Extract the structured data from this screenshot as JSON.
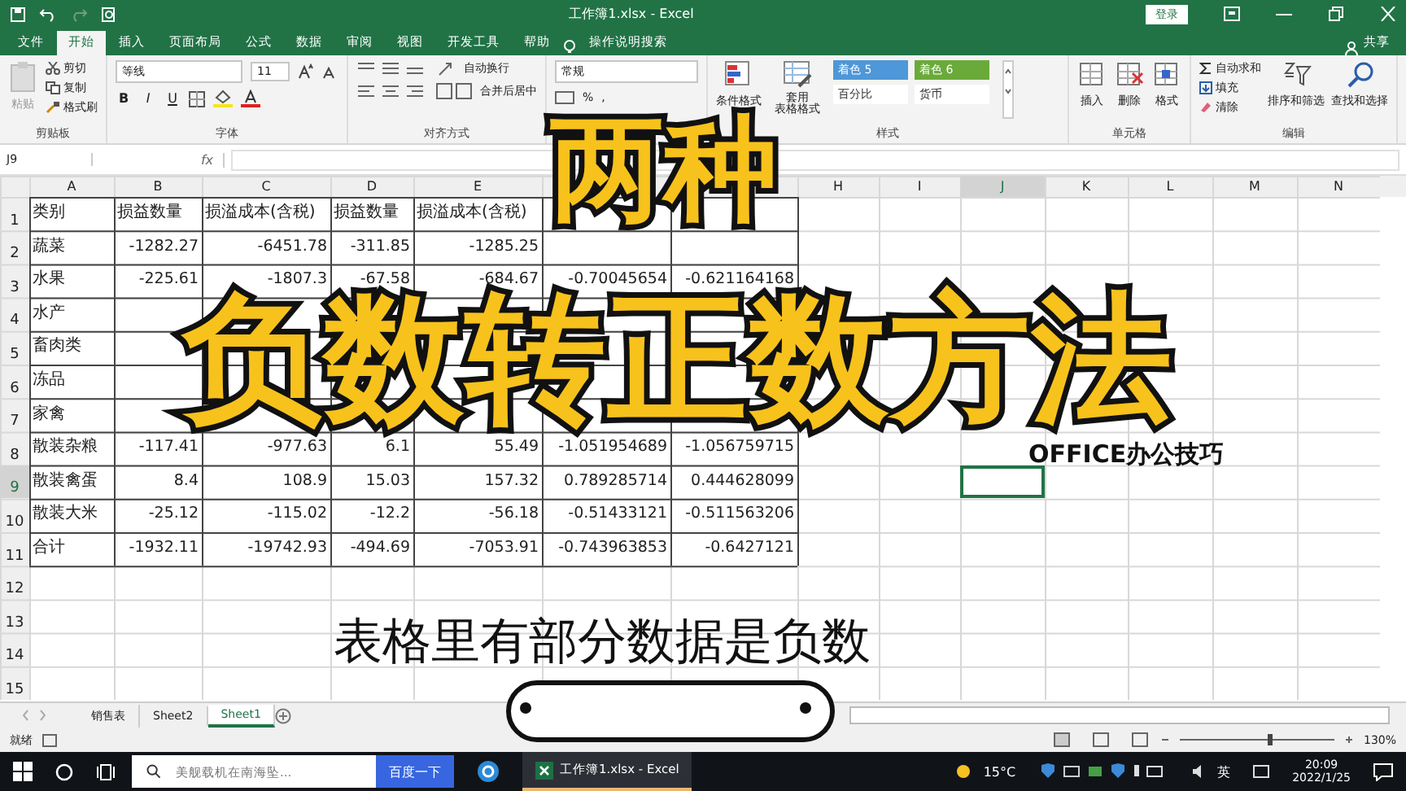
{
  "window": {
    "title": "工作簿1.xlsx - Excel",
    "login": "登录"
  },
  "ribbon_tabs": [
    {
      "label": "文件",
      "selected": false
    },
    {
      "label": "开始",
      "selected": true
    },
    {
      "label": "插入",
      "selected": false
    },
    {
      "label": "页面布局",
      "selected": false
    },
    {
      "label": "公式",
      "selected": false
    },
    {
      "label": "数据",
      "selected": false
    },
    {
      "label": "审阅",
      "selected": false
    },
    {
      "label": "视图",
      "selected": false
    },
    {
      "label": "开发工具",
      "selected": false
    },
    {
      "label": "帮助",
      "selected": false
    }
  ],
  "tell_me": "操作说明搜索",
  "share": "共享",
  "clipboard": {
    "paste": "粘贴",
    "cut": "剪切",
    "copy": "复制",
    "format_painter": "格式刷",
    "group": "剪贴板"
  },
  "font": {
    "name": "等线",
    "size": "11",
    "bold": "B",
    "italic": "I",
    "underline": "U",
    "group": "字体"
  },
  "alignment": {
    "wrap": "自动换行",
    "merge": "合并后居中",
    "group": "对齐方式"
  },
  "number": {
    "format": "常规",
    "percent": "%",
    "comma": ","
  },
  "styles": {
    "conditional": "条件格式",
    "table_format": [
      "套用",
      "表格格式"
    ],
    "gallery": [
      {
        "label": "着色 5",
        "color": "#4e97d8"
      },
      {
        "label": "着色 6",
        "color": "#6aaa3a"
      },
      {
        "label": "百分比",
        "color": "#ffffff"
      },
      {
        "label": "货币",
        "color": "#ffffff"
      }
    ],
    "group": "样式"
  },
  "cells_group": {
    "items": [
      "插入",
      "删除",
      "格式"
    ],
    "group": "单元格"
  },
  "editing": {
    "autosum": "自动求和",
    "fill": "填充",
    "clear": "清除",
    "sort": "排序和筛选",
    "find": "查找和选择",
    "group": "编辑"
  },
  "formula_bar": {
    "name_box": "J9",
    "fx": "fx"
  },
  "sheet": {
    "columns": [
      {
        "label": "A",
        "selected": false
      },
      {
        "label": "B",
        "selected": false
      },
      {
        "label": "C",
        "selected": false
      },
      {
        "label": "D",
        "selected": false
      },
      {
        "label": "E",
        "selected": false
      },
      {
        "selected": false
      },
      {
        "selected": false
      },
      {
        "label": "H",
        "selected": false
      },
      {
        "label": "I",
        "selected": false
      },
      {
        "label": "J",
        "selected": true
      },
      {
        "label": "K",
        "selected": false
      },
      {
        "label": "L",
        "selected": false
      },
      {
        "label": "M",
        "selected": false
      },
      {
        "label": "N",
        "selected": false
      }
    ],
    "rows": [
      {
        "header": "1",
        "selected": false,
        "cells": [
          "类别",
          "损益数量",
          "损溢成本(含税)",
          "损益数量",
          "损溢成本(含税)",
          "",
          ""
        ]
      },
      {
        "header": "2",
        "selected": false,
        "cells": [
          "蔬菜",
          "-1282.27",
          "-6451.78",
          "-311.85",
          "-1285.25",
          "",
          ""
        ]
      },
      {
        "header": "3",
        "selected": false,
        "cells": [
          "水果",
          "-225.61",
          "-1807.3",
          "-67.58",
          "-684.67",
          "-0.70045654",
          "-0.621164168"
        ]
      },
      {
        "header": "4",
        "selected": false,
        "cells": [
          "水产",
          "",
          "",
          "",
          "",
          "",
          ""
        ]
      },
      {
        "header": "5",
        "selected": false,
        "cells": [
          "畜肉类",
          "",
          "",
          "",
          "",
          "",
          ""
        ]
      },
      {
        "header": "6",
        "selected": false,
        "cells": [
          "冻品",
          "",
          "",
          "",
          "",
          "",
          ""
        ]
      },
      {
        "header": "7",
        "selected": false,
        "cells": [
          "家禽",
          "",
          "",
          "",
          "",
          "",
          ""
        ]
      },
      {
        "header": "8",
        "selected": false,
        "cells": [
          "散装杂粮",
          "-117.41",
          "-977.63",
          "6.1",
          "55.49",
          "-1.051954689",
          "-1.056759715"
        ]
      },
      {
        "header": "9",
        "selected": true,
        "cells": [
          "散装禽蛋",
          "8.4",
          "108.9",
          "15.03",
          "157.32",
          "0.789285714",
          "0.444628099"
        ]
      },
      {
        "header": "10",
        "selected": false,
        "cells": [
          "散装大米",
          "-25.12",
          "-115.02",
          "-12.2",
          "-56.18",
          "-0.51433121",
          "-0.511563206"
        ]
      },
      {
        "header": "11",
        "selected": false,
        "cells": [
          "合计",
          "-1932.11",
          "-19742.93",
          "-494.69",
          "-7053.91",
          "-0.743963853",
          "-0.6427121"
        ]
      },
      {
        "header": "12",
        "selected": false,
        "cells": []
      },
      {
        "header": "13",
        "selected": false,
        "cells": []
      },
      {
        "header": "14",
        "selected": false,
        "cells": []
      },
      {
        "header": "15",
        "selected": false,
        "cells": []
      }
    ]
  },
  "sheet_tabs": [
    {
      "label": "销售表",
      "selected": false
    },
    {
      "label": "Sheet2",
      "selected": false
    },
    {
      "label": "Sheet1",
      "selected": true
    }
  ],
  "status_bar": {
    "status": "就绪",
    "zoom": "130%",
    "zoom_slider": {
      "level": 0.58
    }
  },
  "overlay": {
    "title_top": "两种",
    "title_main": "负数转正数方法",
    "brand": "OFFICE办公技巧",
    "subtitle": "表格里有部分数据是负数"
  },
  "taskbar": {
    "search_placeholder": "美舰载机在南海坠...",
    "search_button": "百度一下",
    "app": "工作簿1.xlsx - Excel",
    "temperature": "15°C",
    "ime": "英",
    "time": "20:09",
    "date": "2022/1/25"
  }
}
